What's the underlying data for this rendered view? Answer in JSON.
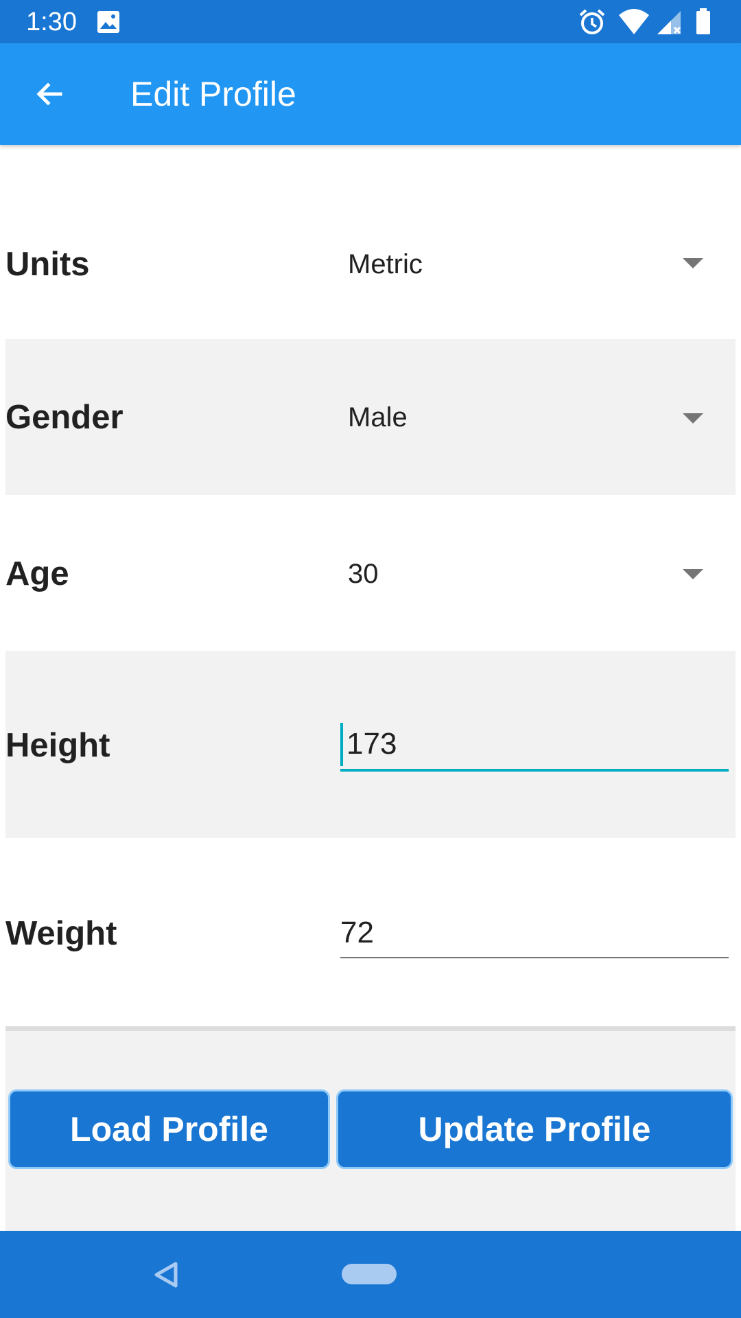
{
  "status_bar": {
    "time": "1:30",
    "icons": [
      "image-icon",
      "alarm-icon",
      "wifi-icon",
      "signal-icon",
      "battery-icon"
    ]
  },
  "app_bar": {
    "back_icon": "arrow-back-icon",
    "title": "Edit Profile"
  },
  "form": {
    "units": {
      "label": "Units",
      "value": "Metric"
    },
    "gender": {
      "label": "Gender",
      "value": "Male"
    },
    "age": {
      "label": "Age",
      "value": "30"
    },
    "height": {
      "label": "Height",
      "value": "173"
    },
    "weight": {
      "label": "Weight",
      "value": "72"
    }
  },
  "buttons": {
    "load": "Load Profile",
    "update": "Update Profile"
  },
  "nav_bar": {
    "icons": [
      "nav-back-icon",
      "nav-home-pill"
    ]
  },
  "colors": {
    "status_bar": "#1976D2",
    "app_bar": "#2196F3",
    "accent": "#00ACC1",
    "button": "#1976D2",
    "row_alt": "#F2F2F2"
  }
}
